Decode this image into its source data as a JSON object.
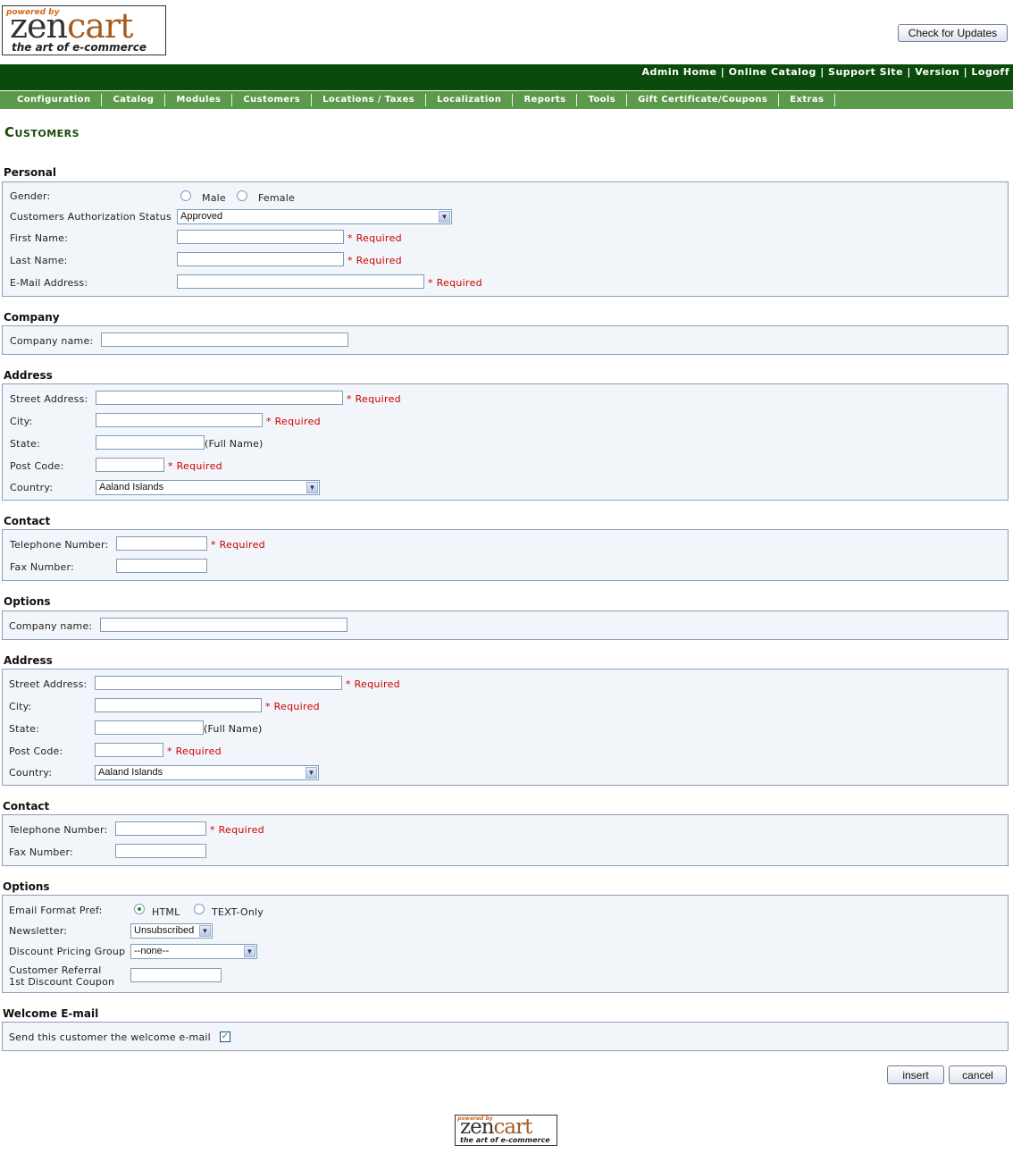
{
  "header": {
    "logo": {
      "powered_by": "powered by",
      "zen": "zen",
      "cart": "cart",
      "tagline": "the art of e-commerce"
    },
    "check_updates_label": "Check for Updates",
    "links": {
      "admin_home": "Admin Home",
      "online_catalog": "Online Catalog",
      "support_site": "Support Site",
      "version": "Version",
      "logoff": "Logoff",
      "sep": " | "
    }
  },
  "menu": [
    "Configuration",
    "Catalog",
    "Modules",
    "Customers",
    "Locations / Taxes",
    "Localization",
    "Reports",
    "Tools",
    "Gift Certificate/Coupons",
    "Extras"
  ],
  "page_title": "Customers",
  "required_text": "* Required",
  "personal": {
    "title": "Personal",
    "gender_label": "Gender:",
    "male": "Male",
    "female": "Female",
    "auth_label": "Customers Authorization Status",
    "auth_value": "Approved",
    "first_name_label": "First Name:",
    "last_name_label": "Last Name:",
    "email_label": "E-Mail Address:"
  },
  "company1": {
    "title": "Company",
    "name_label": "Company name:"
  },
  "address1": {
    "title": "Address",
    "street_label": "Street Address:",
    "city_label": "City:",
    "state_label": "State:",
    "full_name": "(Full Name)",
    "post_label": "Post Code:",
    "country_label": "Country:",
    "country_value": "Aaland Islands"
  },
  "contact1": {
    "title": "Contact",
    "tel_label": "Telephone Number:",
    "fax_label": "Fax Number:"
  },
  "options1": {
    "title": "Options",
    "name_label": "Company name:"
  },
  "address2": {
    "title": "Address",
    "street_label": "Street Address:",
    "city_label": "City:",
    "state_label": "State:",
    "full_name": "(Full Name)",
    "post_label": "Post Code:",
    "country_label": "Country:",
    "country_value": "Aaland Islands"
  },
  "contact2": {
    "title": "Contact",
    "tel_label": "Telephone Number:",
    "fax_label": "Fax Number:"
  },
  "options2": {
    "title": "Options",
    "email_format_label": "Email Format Pref:",
    "html": "HTML",
    "text_only": "TEXT-Only",
    "newsletter_label": "Newsletter:",
    "newsletter_value": "Unsubscribed",
    "discount_label": "Discount Pricing Group",
    "discount_value": "--none--",
    "referral_label_1": "Customer Referral",
    "referral_label_2": "1st Discount Coupon"
  },
  "welcome": {
    "title": "Welcome E-mail",
    "send_label": "Send this customer the welcome e-mail"
  },
  "buttons": {
    "insert": "insert",
    "cancel": "cancel"
  }
}
